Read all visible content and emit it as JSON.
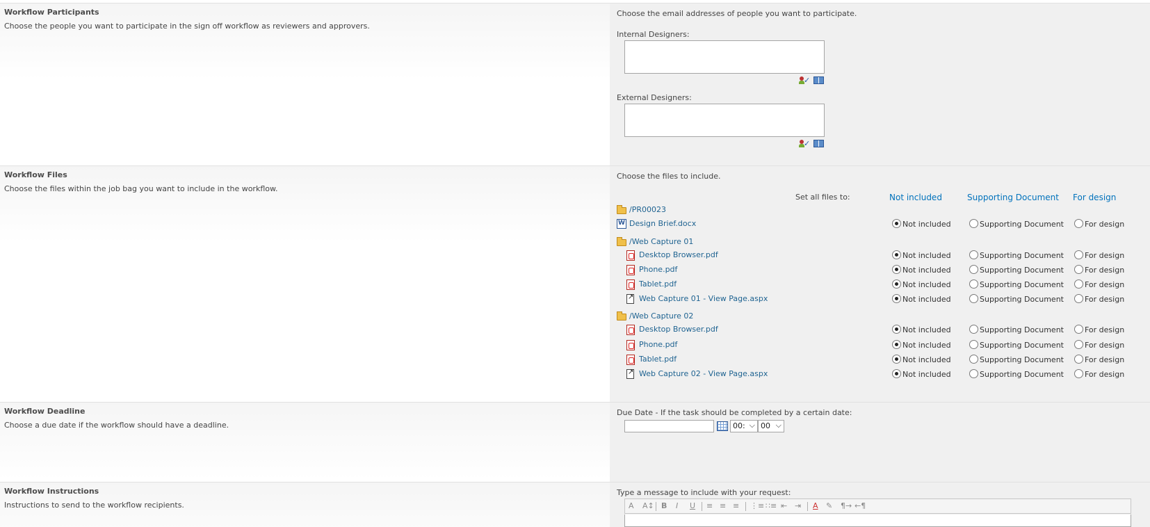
{
  "participants": {
    "title": "Workflow Participants",
    "description": "Choose the people you want to participate in the sign off workflow as reviewers and approvers.",
    "instruction": "Choose the email addresses of people you want to participate.",
    "internal_label": "Internal Designers:",
    "external_label": "External Designers:",
    "internal_value": "",
    "external_value": ""
  },
  "files": {
    "title": "Workflow Files",
    "description": "Choose the files within the job bag you want to include in the workflow.",
    "instruction": "Choose the files to include.",
    "set_all_label": "Set all files to:",
    "set_all_options": [
      "Not included",
      "Supporting Document",
      "For design"
    ],
    "option_labels": {
      "not_included": "Not included",
      "supporting": "Supporting Document",
      "for_design": "For design"
    },
    "root_folder": "/PR00023",
    "root_file": "Design Brief.docx",
    "folder1": "/Web Capture 01",
    "folder1_files": [
      "Desktop Browser.pdf",
      "Phone.pdf",
      "Tablet.pdf",
      "Web Capture 01 - View Page.aspx"
    ],
    "folder2": "/Web Capture 02",
    "folder2_files": [
      "Desktop Browser.pdf",
      "Phone.pdf",
      "Tablet.pdf",
      "Web Capture 02 - View Page.aspx"
    ],
    "selected": "Not included"
  },
  "deadline": {
    "title": "Workflow Deadline",
    "description": "Choose a due date if the workflow should have a deadline.",
    "instruction": "Due Date - If the task should be completed by a certain date:",
    "date_value": "",
    "hour_value": "00:",
    "minute_value": "00"
  },
  "instructions": {
    "title": "Workflow Instructions",
    "description": "Instructions to send to the workflow recipients.",
    "prompt": "Type a message to include with your request:"
  },
  "colors": {
    "link": "#1f6391",
    "header_link": "#0072bc",
    "panel_bg": "#f0f0f0"
  },
  "icons": [
    "people-picker-icon",
    "address-book-icon",
    "folder-icon",
    "pdf-icon",
    "docx-icon",
    "aspx-icon",
    "calendar-icon"
  ]
}
